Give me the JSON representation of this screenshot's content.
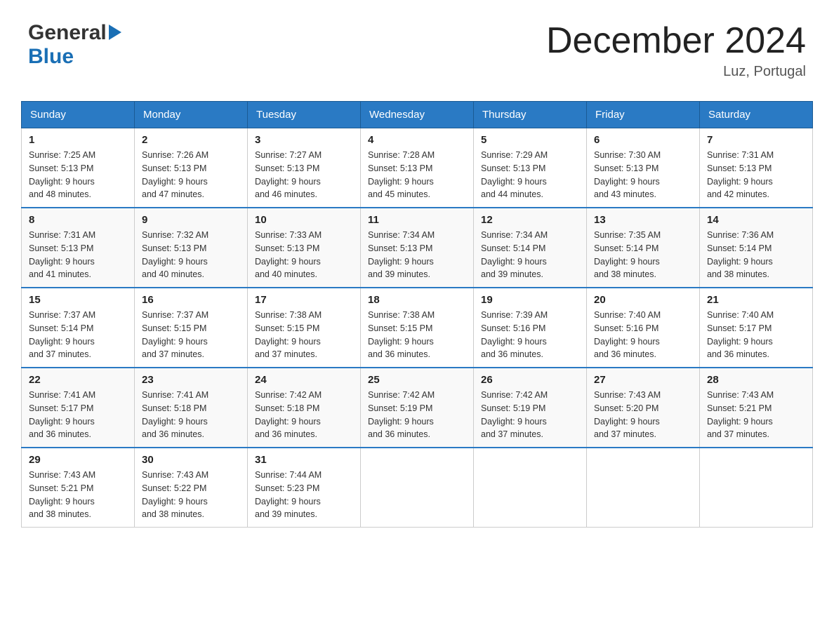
{
  "header": {
    "logo": {
      "general": "General",
      "blue": "Blue",
      "arrow": "▶"
    },
    "title": "December 2024",
    "location": "Luz, Portugal"
  },
  "weekdays": [
    "Sunday",
    "Monday",
    "Tuesday",
    "Wednesday",
    "Thursday",
    "Friday",
    "Saturday"
  ],
  "weeks": [
    [
      {
        "day": "1",
        "sunrise": "7:25 AM",
        "sunset": "5:13 PM",
        "daylight": "9 hours and 48 minutes."
      },
      {
        "day": "2",
        "sunrise": "7:26 AM",
        "sunset": "5:13 PM",
        "daylight": "9 hours and 47 minutes."
      },
      {
        "day": "3",
        "sunrise": "7:27 AM",
        "sunset": "5:13 PM",
        "daylight": "9 hours and 46 minutes."
      },
      {
        "day": "4",
        "sunrise": "7:28 AM",
        "sunset": "5:13 PM",
        "daylight": "9 hours and 45 minutes."
      },
      {
        "day": "5",
        "sunrise": "7:29 AM",
        "sunset": "5:13 PM",
        "daylight": "9 hours and 44 minutes."
      },
      {
        "day": "6",
        "sunrise": "7:30 AM",
        "sunset": "5:13 PM",
        "daylight": "9 hours and 43 minutes."
      },
      {
        "day": "7",
        "sunrise": "7:31 AM",
        "sunset": "5:13 PM",
        "daylight": "9 hours and 42 minutes."
      }
    ],
    [
      {
        "day": "8",
        "sunrise": "7:31 AM",
        "sunset": "5:13 PM",
        "daylight": "9 hours and 41 minutes."
      },
      {
        "day": "9",
        "sunrise": "7:32 AM",
        "sunset": "5:13 PM",
        "daylight": "9 hours and 40 minutes."
      },
      {
        "day": "10",
        "sunrise": "7:33 AM",
        "sunset": "5:13 PM",
        "daylight": "9 hours and 40 minutes."
      },
      {
        "day": "11",
        "sunrise": "7:34 AM",
        "sunset": "5:13 PM",
        "daylight": "9 hours and 39 minutes."
      },
      {
        "day": "12",
        "sunrise": "7:34 AM",
        "sunset": "5:14 PM",
        "daylight": "9 hours and 39 minutes."
      },
      {
        "day": "13",
        "sunrise": "7:35 AM",
        "sunset": "5:14 PM",
        "daylight": "9 hours and 38 minutes."
      },
      {
        "day": "14",
        "sunrise": "7:36 AM",
        "sunset": "5:14 PM",
        "daylight": "9 hours and 38 minutes."
      }
    ],
    [
      {
        "day": "15",
        "sunrise": "7:37 AM",
        "sunset": "5:14 PM",
        "daylight": "9 hours and 37 minutes."
      },
      {
        "day": "16",
        "sunrise": "7:37 AM",
        "sunset": "5:15 PM",
        "daylight": "9 hours and 37 minutes."
      },
      {
        "day": "17",
        "sunrise": "7:38 AM",
        "sunset": "5:15 PM",
        "daylight": "9 hours and 37 minutes."
      },
      {
        "day": "18",
        "sunrise": "7:38 AM",
        "sunset": "5:15 PM",
        "daylight": "9 hours and 36 minutes."
      },
      {
        "day": "19",
        "sunrise": "7:39 AM",
        "sunset": "5:16 PM",
        "daylight": "9 hours and 36 minutes."
      },
      {
        "day": "20",
        "sunrise": "7:40 AM",
        "sunset": "5:16 PM",
        "daylight": "9 hours and 36 minutes."
      },
      {
        "day": "21",
        "sunrise": "7:40 AM",
        "sunset": "5:17 PM",
        "daylight": "9 hours and 36 minutes."
      }
    ],
    [
      {
        "day": "22",
        "sunrise": "7:41 AM",
        "sunset": "5:17 PM",
        "daylight": "9 hours and 36 minutes."
      },
      {
        "day": "23",
        "sunrise": "7:41 AM",
        "sunset": "5:18 PM",
        "daylight": "9 hours and 36 minutes."
      },
      {
        "day": "24",
        "sunrise": "7:42 AM",
        "sunset": "5:18 PM",
        "daylight": "9 hours and 36 minutes."
      },
      {
        "day": "25",
        "sunrise": "7:42 AM",
        "sunset": "5:19 PM",
        "daylight": "9 hours and 36 minutes."
      },
      {
        "day": "26",
        "sunrise": "7:42 AM",
        "sunset": "5:19 PM",
        "daylight": "9 hours and 37 minutes."
      },
      {
        "day": "27",
        "sunrise": "7:43 AM",
        "sunset": "5:20 PM",
        "daylight": "9 hours and 37 minutes."
      },
      {
        "day": "28",
        "sunrise": "7:43 AM",
        "sunset": "5:21 PM",
        "daylight": "9 hours and 37 minutes."
      }
    ],
    [
      {
        "day": "29",
        "sunrise": "7:43 AM",
        "sunset": "5:21 PM",
        "daylight": "9 hours and 38 minutes."
      },
      {
        "day": "30",
        "sunrise": "7:43 AM",
        "sunset": "5:22 PM",
        "daylight": "9 hours and 38 minutes."
      },
      {
        "day": "31",
        "sunrise": "7:44 AM",
        "sunset": "5:23 PM",
        "daylight": "9 hours and 39 minutes."
      },
      null,
      null,
      null,
      null
    ]
  ],
  "labels": {
    "sunrise_prefix": "Sunrise: ",
    "sunset_prefix": "Sunset: ",
    "daylight_prefix": "Daylight: "
  }
}
